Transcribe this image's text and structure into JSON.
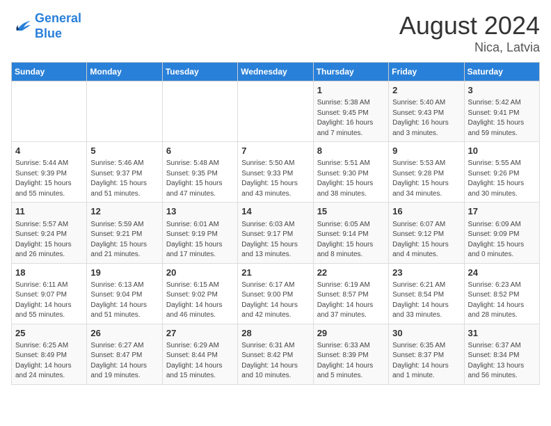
{
  "logo": {
    "line1": "General",
    "line2": "Blue"
  },
  "title": "August 2024",
  "location": "Nica, Latvia",
  "days_of_week": [
    "Sunday",
    "Monday",
    "Tuesday",
    "Wednesday",
    "Thursday",
    "Friday",
    "Saturday"
  ],
  "weeks": [
    [
      {
        "day": "",
        "content": ""
      },
      {
        "day": "",
        "content": ""
      },
      {
        "day": "",
        "content": ""
      },
      {
        "day": "",
        "content": ""
      },
      {
        "day": "1",
        "content": "Sunrise: 5:38 AM\nSunset: 9:45 PM\nDaylight: 16 hours\nand 7 minutes."
      },
      {
        "day": "2",
        "content": "Sunrise: 5:40 AM\nSunset: 9:43 PM\nDaylight: 16 hours\nand 3 minutes."
      },
      {
        "day": "3",
        "content": "Sunrise: 5:42 AM\nSunset: 9:41 PM\nDaylight: 15 hours\nand 59 minutes."
      }
    ],
    [
      {
        "day": "4",
        "content": "Sunrise: 5:44 AM\nSunset: 9:39 PM\nDaylight: 15 hours\nand 55 minutes."
      },
      {
        "day": "5",
        "content": "Sunrise: 5:46 AM\nSunset: 9:37 PM\nDaylight: 15 hours\nand 51 minutes."
      },
      {
        "day": "6",
        "content": "Sunrise: 5:48 AM\nSunset: 9:35 PM\nDaylight: 15 hours\nand 47 minutes."
      },
      {
        "day": "7",
        "content": "Sunrise: 5:50 AM\nSunset: 9:33 PM\nDaylight: 15 hours\nand 43 minutes."
      },
      {
        "day": "8",
        "content": "Sunrise: 5:51 AM\nSunset: 9:30 PM\nDaylight: 15 hours\nand 38 minutes."
      },
      {
        "day": "9",
        "content": "Sunrise: 5:53 AM\nSunset: 9:28 PM\nDaylight: 15 hours\nand 34 minutes."
      },
      {
        "day": "10",
        "content": "Sunrise: 5:55 AM\nSunset: 9:26 PM\nDaylight: 15 hours\nand 30 minutes."
      }
    ],
    [
      {
        "day": "11",
        "content": "Sunrise: 5:57 AM\nSunset: 9:24 PM\nDaylight: 15 hours\nand 26 minutes."
      },
      {
        "day": "12",
        "content": "Sunrise: 5:59 AM\nSunset: 9:21 PM\nDaylight: 15 hours\nand 21 minutes."
      },
      {
        "day": "13",
        "content": "Sunrise: 6:01 AM\nSunset: 9:19 PM\nDaylight: 15 hours\nand 17 minutes."
      },
      {
        "day": "14",
        "content": "Sunrise: 6:03 AM\nSunset: 9:17 PM\nDaylight: 15 hours\nand 13 minutes."
      },
      {
        "day": "15",
        "content": "Sunrise: 6:05 AM\nSunset: 9:14 PM\nDaylight: 15 hours\nand 8 minutes."
      },
      {
        "day": "16",
        "content": "Sunrise: 6:07 AM\nSunset: 9:12 PM\nDaylight: 15 hours\nand 4 minutes."
      },
      {
        "day": "17",
        "content": "Sunrise: 6:09 AM\nSunset: 9:09 PM\nDaylight: 15 hours\nand 0 minutes."
      }
    ],
    [
      {
        "day": "18",
        "content": "Sunrise: 6:11 AM\nSunset: 9:07 PM\nDaylight: 14 hours\nand 55 minutes."
      },
      {
        "day": "19",
        "content": "Sunrise: 6:13 AM\nSunset: 9:04 PM\nDaylight: 14 hours\nand 51 minutes."
      },
      {
        "day": "20",
        "content": "Sunrise: 6:15 AM\nSunset: 9:02 PM\nDaylight: 14 hours\nand 46 minutes."
      },
      {
        "day": "21",
        "content": "Sunrise: 6:17 AM\nSunset: 9:00 PM\nDaylight: 14 hours\nand 42 minutes."
      },
      {
        "day": "22",
        "content": "Sunrise: 6:19 AM\nSunset: 8:57 PM\nDaylight: 14 hours\nand 37 minutes."
      },
      {
        "day": "23",
        "content": "Sunrise: 6:21 AM\nSunset: 8:54 PM\nDaylight: 14 hours\nand 33 minutes."
      },
      {
        "day": "24",
        "content": "Sunrise: 6:23 AM\nSunset: 8:52 PM\nDaylight: 14 hours\nand 28 minutes."
      }
    ],
    [
      {
        "day": "25",
        "content": "Sunrise: 6:25 AM\nSunset: 8:49 PM\nDaylight: 14 hours\nand 24 minutes."
      },
      {
        "day": "26",
        "content": "Sunrise: 6:27 AM\nSunset: 8:47 PM\nDaylight: 14 hours\nand 19 minutes."
      },
      {
        "day": "27",
        "content": "Sunrise: 6:29 AM\nSunset: 8:44 PM\nDaylight: 14 hours\nand 15 minutes."
      },
      {
        "day": "28",
        "content": "Sunrise: 6:31 AM\nSunset: 8:42 PM\nDaylight: 14 hours\nand 10 minutes."
      },
      {
        "day": "29",
        "content": "Sunrise: 6:33 AM\nSunset: 8:39 PM\nDaylight: 14 hours\nand 5 minutes."
      },
      {
        "day": "30",
        "content": "Sunrise: 6:35 AM\nSunset: 8:37 PM\nDaylight: 14 hours\nand 1 minute."
      },
      {
        "day": "31",
        "content": "Sunrise: 6:37 AM\nSunset: 8:34 PM\nDaylight: 13 hours\nand 56 minutes."
      }
    ]
  ]
}
